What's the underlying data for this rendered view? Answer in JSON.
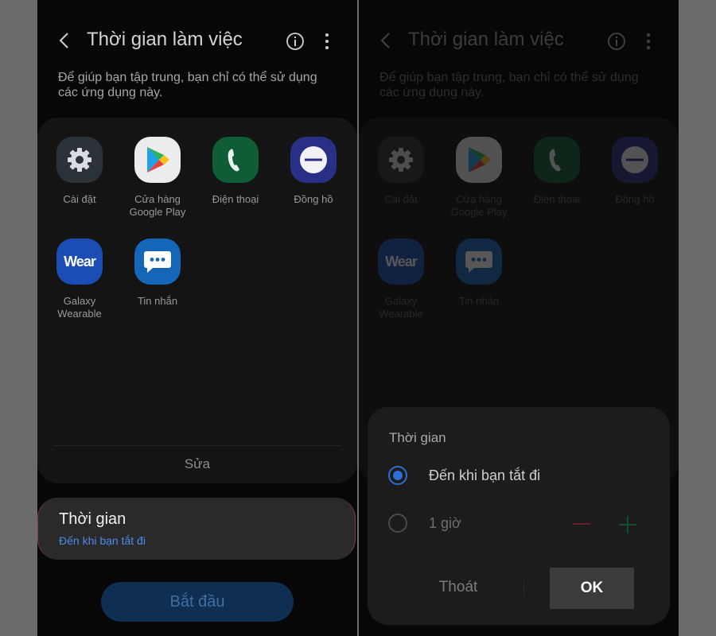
{
  "screen": {
    "title": "Thời gian làm việc",
    "description": "Để giúp bạn tập trung, bạn chỉ có thể sử dụng các ứng dụng này.",
    "apps": [
      {
        "label": "Cài đặt",
        "icon": "gear-icon",
        "color": "#2b3238"
      },
      {
        "label": "Cửa hàng Google Play",
        "icon": "play-store-icon",
        "color": "#ececec"
      },
      {
        "label": "Điện thoại",
        "icon": "phone-icon",
        "color": "#0f5d37"
      },
      {
        "label": "Đồng hồ",
        "icon": "clock-icon",
        "color": "#2a2f86"
      },
      {
        "label": "Galaxy Wearable",
        "icon": "wear-icon",
        "color": "#1b4db5",
        "icon_text": "Wear"
      },
      {
        "label": "Tin nhắn",
        "icon": "message-icon",
        "color": "#1565b8"
      }
    ],
    "edit_label": "Sửa",
    "time_card": {
      "title": "Thời gian",
      "value": "Đến khi bạn tắt đi"
    },
    "start_label": "Bắt đầu"
  },
  "dialog": {
    "title": "Thời gian",
    "options": [
      {
        "label": "Đến khi bạn tắt đi",
        "selected": true
      },
      {
        "label": "1 giờ",
        "selected": false
      }
    ],
    "cancel_label": "Thoát",
    "ok_label": "OK"
  },
  "colors": {
    "accent": "#2f6fd6",
    "link": "#4d8bea",
    "background": "#070707"
  }
}
